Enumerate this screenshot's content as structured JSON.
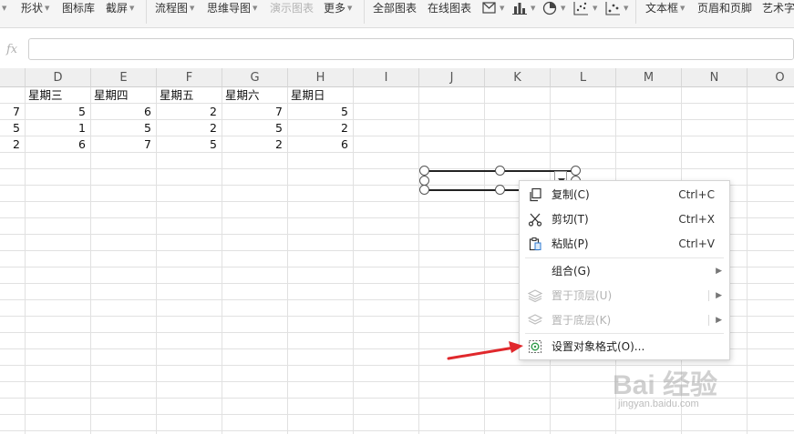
{
  "toolbar": {
    "items": [
      {
        "label": "形状",
        "dropdown": true
      },
      {
        "label": "图标库",
        "dropdown": false
      },
      {
        "label": "截屏",
        "dropdown": true
      },
      {
        "label": "流程图",
        "dropdown": true
      },
      {
        "label": "思维导图",
        "dropdown": true
      },
      {
        "label": "演示图表",
        "dropdown": false,
        "disabled": true
      },
      {
        "label": "更多",
        "dropdown": true
      },
      {
        "label": "全部图表",
        "dropdown": false
      },
      {
        "label": "在线图表",
        "dropdown": false
      },
      {
        "label": "文本框",
        "dropdown": true
      },
      {
        "label": "页眉和页脚",
        "dropdown": false
      },
      {
        "label": "艺术字",
        "dropdown": false
      }
    ],
    "chart_icons": [
      "mail-chart-icon",
      "bar-chart-icon",
      "pie-chart-icon",
      "scatter-chart-icon",
      "scatter-chart-2-icon"
    ]
  },
  "formula_bar": {
    "fx_label": "fx",
    "value": ""
  },
  "columns": [
    "D",
    "E",
    "F",
    "G",
    "H",
    "I",
    "J",
    "K",
    "L",
    "M",
    "N",
    "O"
  ],
  "table": {
    "partial_col_values": [
      "",
      "7",
      "5",
      "2"
    ],
    "headers": [
      "星期三",
      "星期四",
      "星期五",
      "星期六",
      "星期日"
    ],
    "rows": [
      [
        "5",
        "6",
        "2",
        "7",
        "5"
      ],
      [
        "1",
        "5",
        "2",
        "5",
        "2"
      ],
      [
        "6",
        "7",
        "5",
        "2",
        "6"
      ]
    ]
  },
  "context_menu": {
    "items": [
      {
        "label": "复制(C)",
        "shortcut": "Ctrl+C",
        "icon": "copy-icon",
        "disabled": false
      },
      {
        "label": "剪切(T)",
        "shortcut": "Ctrl+X",
        "icon": "scissors-icon",
        "disabled": false
      },
      {
        "label": "粘贴(P)",
        "shortcut": "Ctrl+V",
        "icon": "paste-icon",
        "disabled": false
      },
      {
        "label": "组合(G)",
        "shortcut": "",
        "icon": "",
        "disabled": false,
        "submenu": true
      },
      {
        "label": "置于顶层(U)",
        "shortcut": "",
        "icon": "bring-to-front-icon",
        "disabled": true,
        "submenu": true
      },
      {
        "label": "置于底层(K)",
        "shortcut": "",
        "icon": "send-to-back-icon",
        "disabled": true,
        "submenu": true
      },
      {
        "label": "设置对象格式(O)...",
        "shortcut": "",
        "icon": "format-object-icon",
        "disabled": false
      }
    ]
  },
  "watermark": {
    "logo": "Bai 经验",
    "url": "jingyan.baidu.com"
  },
  "colors": {
    "accent": "#e0282c",
    "menu_text": "#222222",
    "disabled_text": "#b3b3b3"
  }
}
